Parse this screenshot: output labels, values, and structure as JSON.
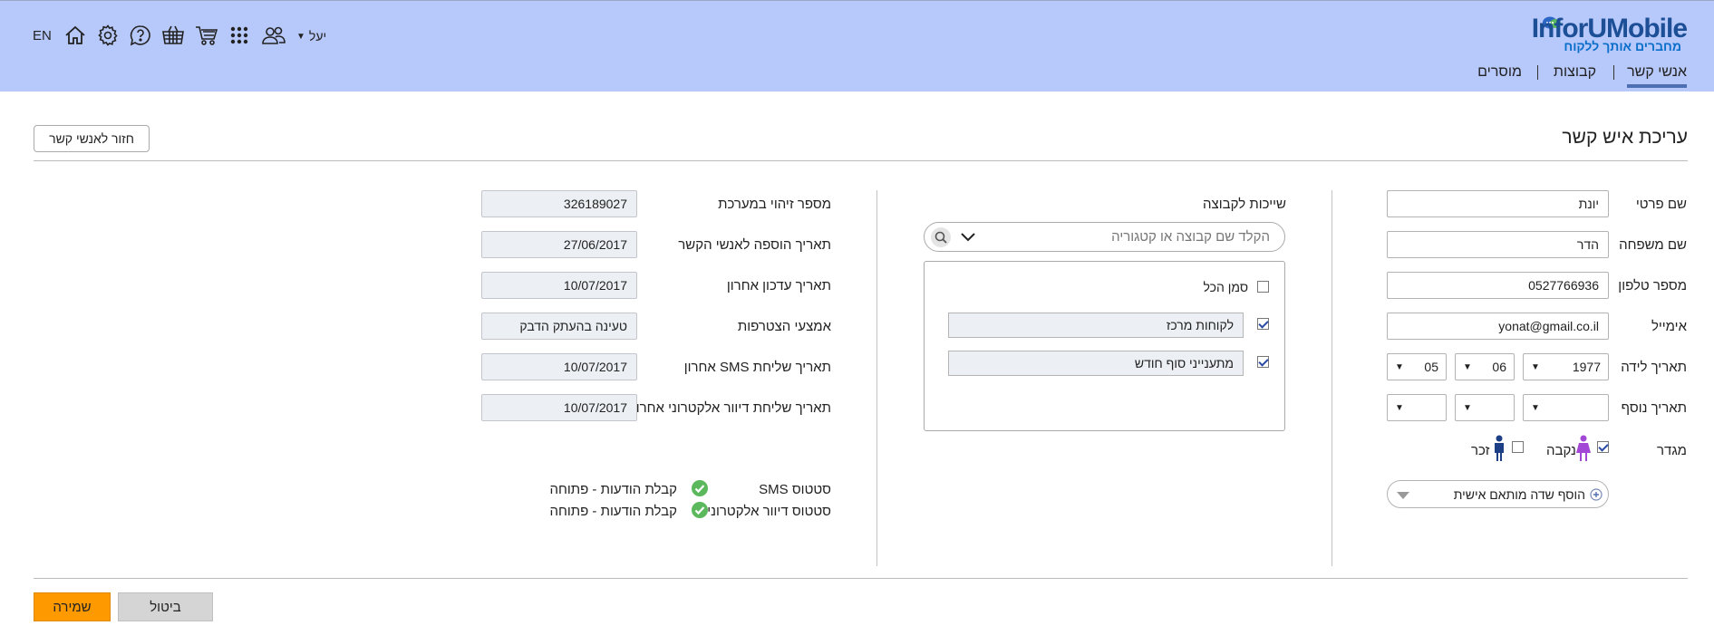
{
  "header": {
    "logo_text": "InforUMobile",
    "logo_tagline": "מחברים אותך ללקוח",
    "lang": "EN",
    "user_name": "יעל",
    "nav": [
      {
        "label": "אנשי קשר",
        "active": true
      },
      {
        "label": "קבוצות",
        "active": false
      },
      {
        "label": "מוסרים",
        "active": false
      }
    ],
    "icons": [
      "home-icon",
      "gear-icon",
      "help-icon",
      "basket-icon",
      "cart-icon",
      "apps-grid-icon",
      "users-icon"
    ],
    "bg_color": "#b7c8fb",
    "accent_color": "#4f6fb4"
  },
  "page": {
    "title": "עריכת איש קשר",
    "back_label": "חזור לאנשי קשר"
  },
  "personal": {
    "first_name_label": "שם פרטי",
    "first_name": "יונת",
    "last_name_label": "שם משפחה",
    "last_name": "הדר",
    "phone_label": "מספר טלפון",
    "phone": "0527766936",
    "email_label": "אימייל",
    "email": "yonat@gmail.co.il",
    "birthdate_label": "תאריך לידה",
    "birth_year": "1977",
    "birth_month": "06",
    "birth_day": "05",
    "extra_date_label": "תאריך נוסף",
    "extra_year": "",
    "extra_month": "",
    "extra_day": "",
    "gender_label": "מגדר",
    "female_label": "נקבה",
    "male_label": "זכר",
    "female_checked": true,
    "male_checked": false,
    "add_custom_field_label": "הוסף שדה מותאם אישית"
  },
  "groups": {
    "title": "שייכות לקבוצה",
    "search_placeholder": "הקלד שם קבוצה או קטגוריה",
    "select_all_label": "סמן הכל",
    "select_all_checked": false,
    "items": [
      {
        "label": "לקוחות מרכז",
        "checked": true
      },
      {
        "label": "מתענייני סוף חודש",
        "checked": true
      }
    ]
  },
  "system": {
    "id_label": "מספר זיהוי במערכת",
    "id_value": "326189027",
    "added_label": "תאריך הוספה לאנשי הקשר",
    "added_value": "27/06/2017",
    "updated_label": "תאריך עדכון אחרון",
    "updated_value": "10/07/2017",
    "join_method_label": "אמצעי הצטרפות",
    "join_method_value": "טעינה בהעתק הדבק",
    "last_sms_label": "תאריך שליחת SMS אחרון",
    "last_sms_value": "10/07/2017",
    "last_email_label": "תאריך שליחת דיוור אלקטרוני אחרון",
    "last_email_value": "10/07/2017",
    "sms_status_label": "סטטוס SMS",
    "sms_status_value": "קבלת הודעות - פתוחה",
    "email_status_label": "סטטוס דיוור אלקטרוני",
    "email_status_value": "קבלת הודעות - פתוחה",
    "status_ok_color": "#5cb85c"
  },
  "actions": {
    "save_label": "שמירה",
    "cancel_label": "ביטול",
    "save_color": "#ff9900"
  }
}
